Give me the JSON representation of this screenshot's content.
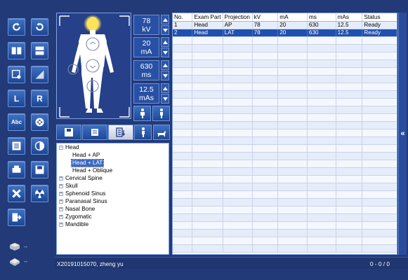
{
  "parameters": {
    "kv": {
      "value": "78",
      "unit": "kV"
    },
    "ma": {
      "value": "20",
      "unit": "mA"
    },
    "ms": {
      "value": "630",
      "unit": "ms"
    },
    "mas": {
      "value": "12.5",
      "unit": "mAs"
    }
  },
  "tree": {
    "items": [
      {
        "label": "Head",
        "expanded": true
      },
      {
        "label": "Head + AP"
      },
      {
        "label": "Head + LAT",
        "selected": true
      },
      {
        "label": "Head + Oblique"
      },
      {
        "label": "Cervical Spine"
      },
      {
        "label": "Skull"
      },
      {
        "label": "Sphenoid Sinus"
      },
      {
        "label": "Paranasal Sinus"
      },
      {
        "label": "Nasal Bone"
      },
      {
        "label": "Zygomatic"
      },
      {
        "label": "Mandible"
      }
    ]
  },
  "exam_table": {
    "columns": [
      "No.",
      "Exam Part",
      "Projection",
      "kV",
      "mA",
      "ms",
      "mAs",
      "Status"
    ],
    "rows": [
      [
        "1",
        "Head",
        "AP",
        "78",
        "20",
        "630",
        "12.5",
        "Ready"
      ],
      [
        "2",
        "Head",
        "LAT",
        "78",
        "20",
        "630",
        "12.5",
        "Ready"
      ]
    ],
    "selected_row": 1
  },
  "toolbar": {
    "l_label": "L",
    "r_label": "R",
    "abc_label": "Abc"
  },
  "side_status": {
    "printer_text": "--",
    "film_text": "--"
  },
  "collapse_label": "«",
  "statusbar": {
    "patient": "X20191015070, zheng yu",
    "counter": "0 - 0 / 0"
  },
  "colors": {
    "background": "#233a78",
    "selected_row": "#1f4fb0",
    "exposure_indicator": "#ffe35a"
  }
}
